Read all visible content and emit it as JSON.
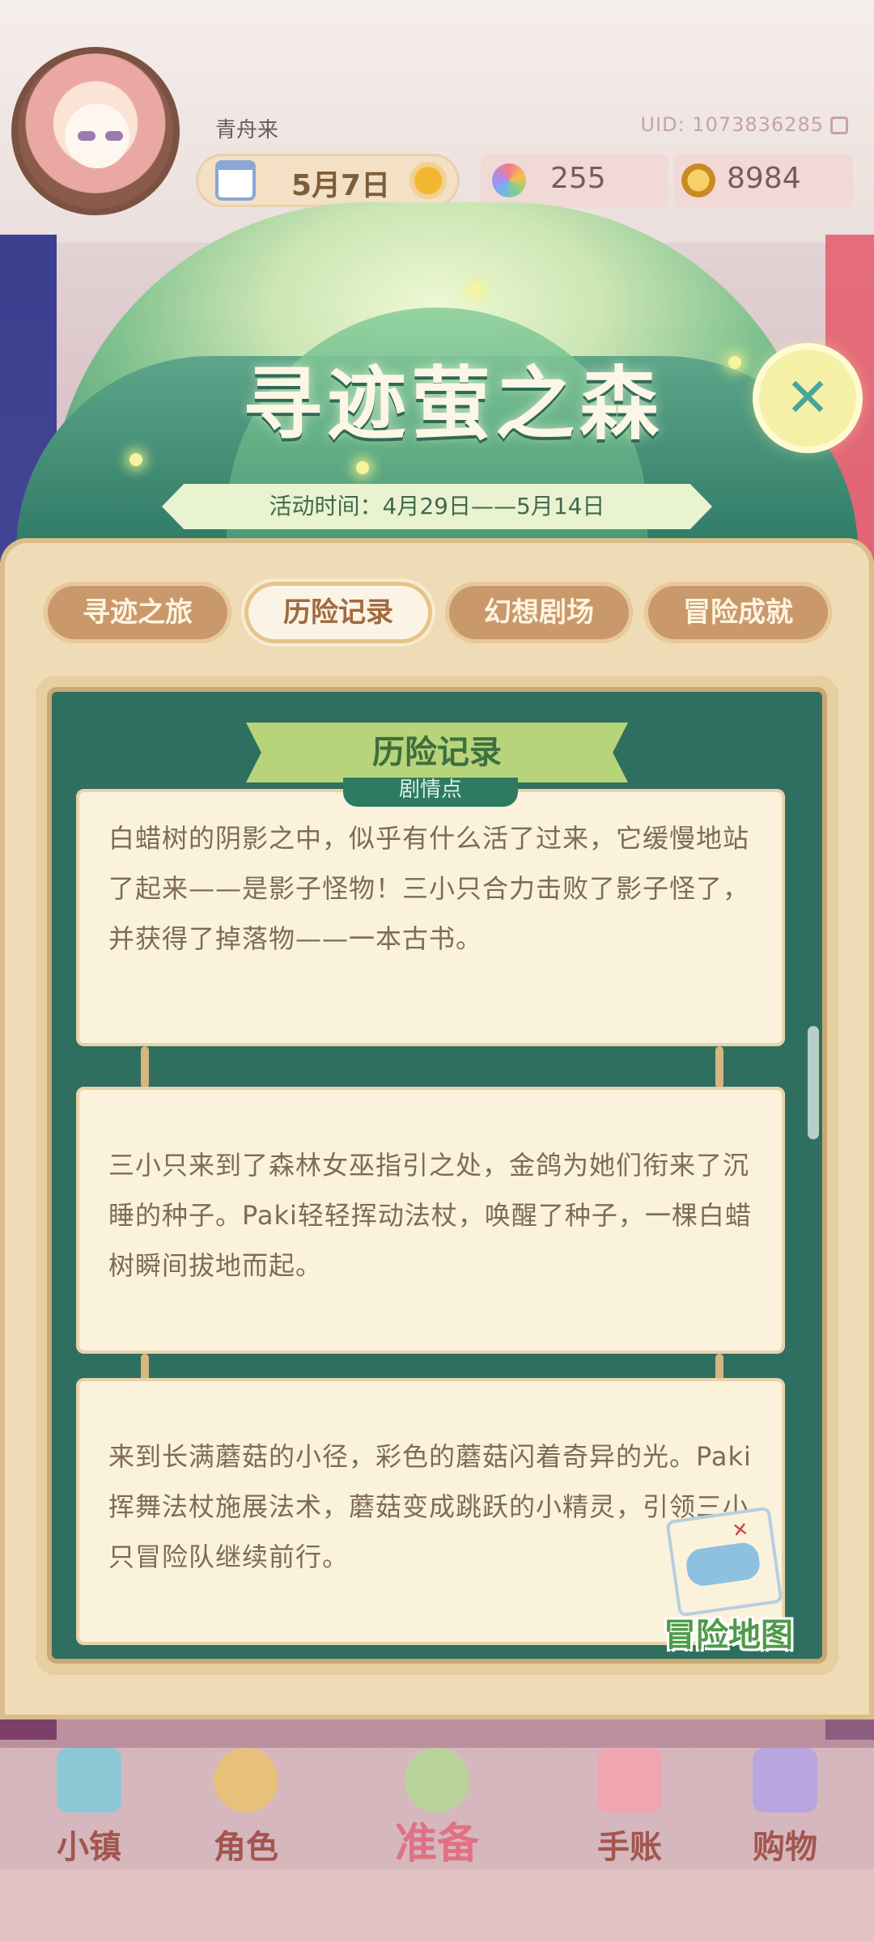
{
  "header": {
    "username": "青舟来",
    "uid": "UID: 1073836285",
    "date": "5月7日",
    "gems": "255",
    "coins": "8984"
  },
  "event": {
    "title": "寻迹萤之森",
    "time_range": "活动时间：4月29日——5月14日"
  },
  "tabs": [
    {
      "label": "寻迹之旅",
      "active": false
    },
    {
      "label": "历险记录",
      "active": true
    },
    {
      "label": "幻想剧场",
      "active": false
    },
    {
      "label": "冒险成就",
      "active": false
    }
  ],
  "board": {
    "title": "历险记录",
    "cards": [
      {
        "tag": "剧情点",
        "text": "白蜡树的阴影之中，似乎有什么活了过来，它缓慢地站了起来——是影子怪物！三小只合力击败了影子怪了，并获得了掉落物——一本古书。"
      },
      {
        "text": "三小只来到了森林女巫指引之处，金鸽为她们衔来了沉睡的种子。Paki轻轻挥动法杖，唤醒了种子，一棵白蜡树瞬间拔地而起。"
      },
      {
        "text": "来到长满蘑菇的小径，彩色的蘑菇闪着奇异的光。Paki挥舞法杖施展法术，蘑菇变成跳跃的小精灵，引领三小只冒险队继续前行。"
      }
    ]
  },
  "map_button": {
    "label": "冒险地图",
    "icon": "treasure-map-icon"
  },
  "bottom_nav": [
    {
      "label": "小镇",
      "icon": "town-map-icon"
    },
    {
      "label": "角色",
      "icon": "bunny-character-icon"
    },
    {
      "label": "准备",
      "icon": "bouquet-icon"
    },
    {
      "label": "手账",
      "icon": "journal-icon"
    },
    {
      "label": "购物",
      "icon": "shopping-bag-icon"
    }
  ],
  "colors": {
    "board_green": "#2f6f60",
    "frame_tan": "#efdcb6",
    "accent_green": "#b8d47a"
  }
}
